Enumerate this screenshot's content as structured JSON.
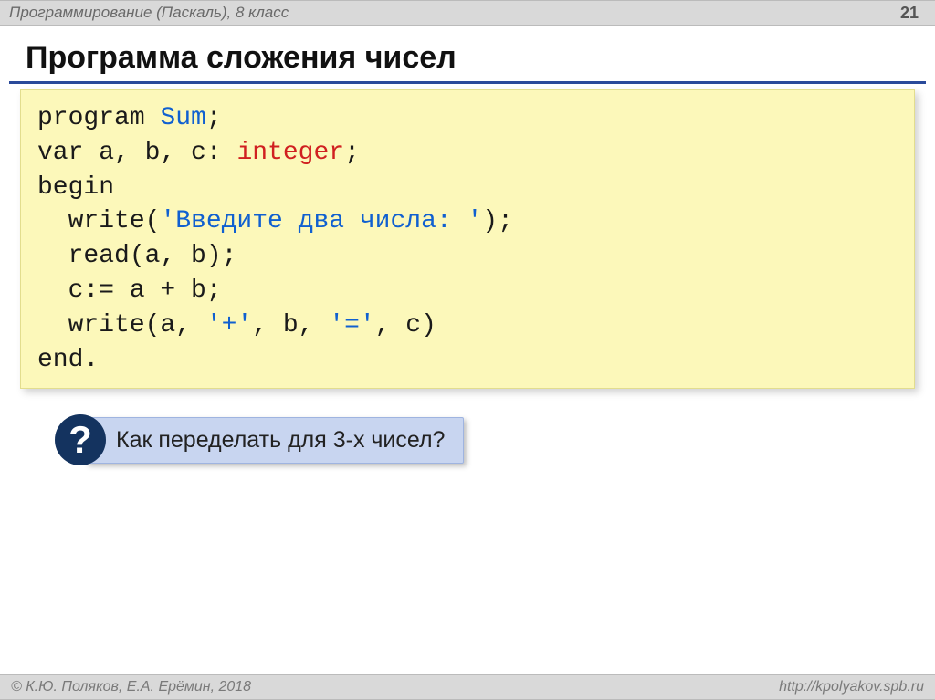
{
  "header": {
    "subject": "Программирование (Паскаль), 8 класс",
    "page_number": "21"
  },
  "title": "Программа сложения чисел",
  "code": {
    "l1a": "program ",
    "l1b": "Sum",
    "l1c": ";",
    "l2a": "var a, b, c: ",
    "l2b": "integer",
    "l2c": ";",
    "l3": "begin",
    "l4a": "  write(",
    "l4b": "'Введите два числа: '",
    "l4c": ");",
    "l5": "  read(a, b);",
    "l6": "  c:= a + b;",
    "l7a": "  write(a, ",
    "l7b": "'+'",
    "l7c": ", b, ",
    "l7d": "'='",
    "l7e": ", c)",
    "l8": "end."
  },
  "question": {
    "badge": "?",
    "text": "Как переделать для 3-х чисел?"
  },
  "footer": {
    "left": "© К.Ю. Поляков, Е.А. Ерёмин, 2018",
    "right": "http://kpolyakov.spb.ru"
  }
}
